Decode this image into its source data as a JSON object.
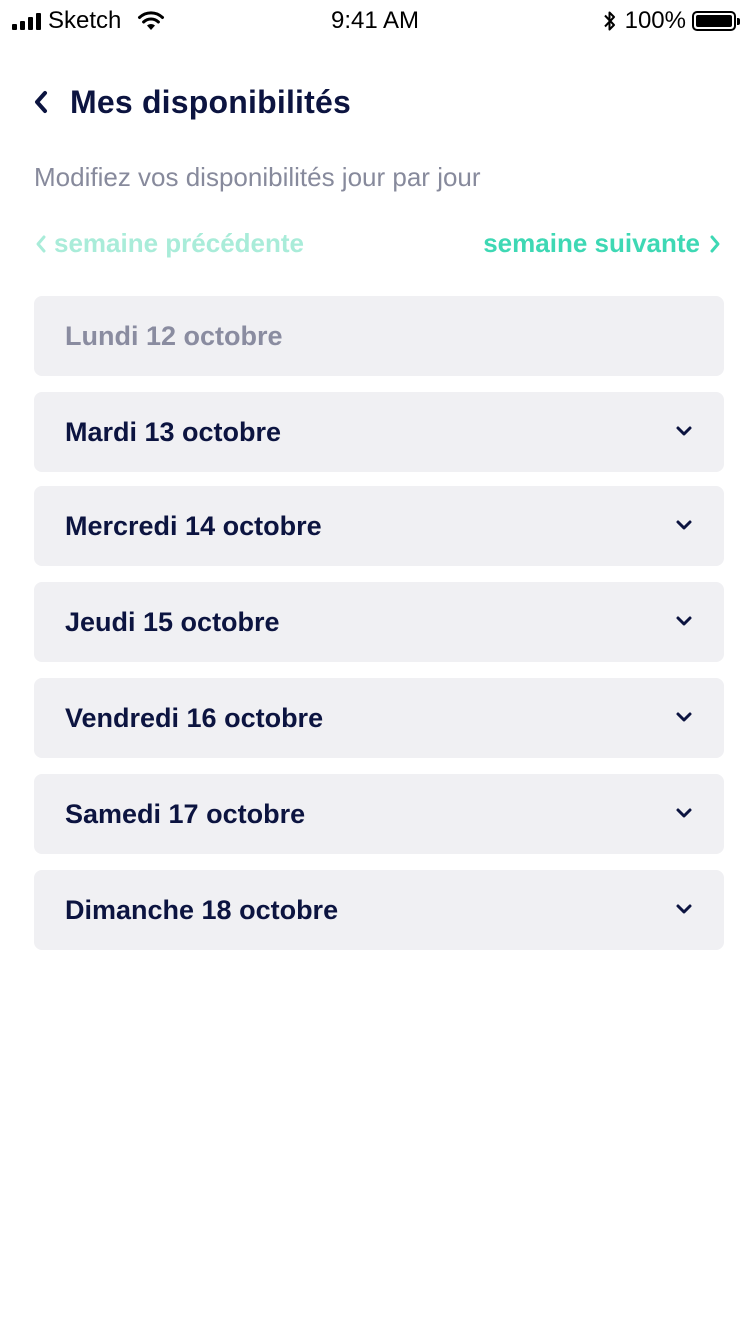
{
  "status_bar": {
    "carrier": "Sketch",
    "time": "9:41 AM",
    "battery": "100%"
  },
  "header": {
    "title": "Mes disponibilités",
    "back_icon": "chevron-left-icon"
  },
  "subtitle": "Modifiez vos disponibilités jour par jour",
  "week_nav": {
    "previous_label": "semaine précédente",
    "next_label": "semaine suivante",
    "previous_color": "#a9ecd9",
    "next_color": "#3ed8b4"
  },
  "days": [
    {
      "label": "Lundi 12 octobre",
      "enabled": false
    },
    {
      "label": "Mardi 13 octobre",
      "enabled": true
    },
    {
      "label": "Mercredi 14 octobre",
      "enabled": true
    },
    {
      "label": "Jeudi 15 octobre",
      "enabled": true
    },
    {
      "label": "Vendredi 16 octobre",
      "enabled": true
    },
    {
      "label": "Samedi 17 octobre",
      "enabled": true
    },
    {
      "label": "Dimanche 18 octobre",
      "enabled": true
    }
  ],
  "colors": {
    "title": "#0c1440",
    "row_background": "#f0f0f3",
    "muted_text": "#878a9c"
  }
}
